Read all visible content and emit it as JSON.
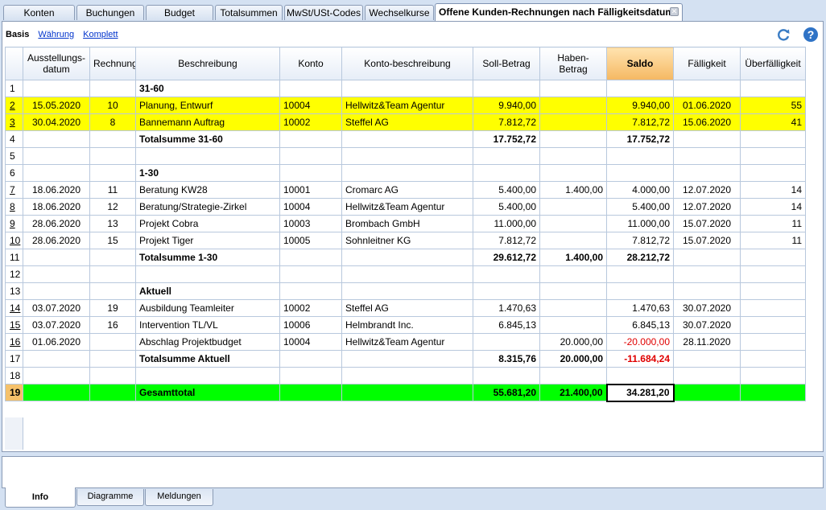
{
  "tabs": [
    {
      "label": "Konten"
    },
    {
      "label": "Buchungen"
    },
    {
      "label": "Budget"
    },
    {
      "label": "Totalsummen"
    },
    {
      "label": "MwSt/USt-Codes"
    },
    {
      "label": "Wechselkurse"
    },
    {
      "label": "Offene Kunden-Rechnungen nach Fälligkeitsdatum"
    }
  ],
  "views": {
    "basis": "Basis",
    "waehrung": "Währung",
    "komplett": "Komplett"
  },
  "icons": {
    "refresh": "refresh-icon",
    "help": "help-icon",
    "close": "close-icon"
  },
  "columns": {
    "date": "Ausstellungs-datum",
    "invoice": "Rechnung",
    "desc": "Beschreibung",
    "account": "Konto",
    "account_desc": "Konto-beschreibung",
    "debit": "Soll-Betrag",
    "credit": "Haben-Betrag",
    "balance": "Saldo",
    "due": "Fälligkeit",
    "overdue": "Überfälligkeit"
  },
  "rows": [
    {
      "n": "1",
      "date": "",
      "inv": "",
      "desc": "31-60",
      "acc": "",
      "accd": "",
      "debit": "",
      "credit": "",
      "bal": "",
      "due": "",
      "over": ""
    },
    {
      "n": "2",
      "date": "15.05.2020",
      "inv": "10",
      "desc": "Planung, Entwurf",
      "acc": "10004",
      "accd": "Hellwitz&Team Agentur",
      "debit": "9.940,00",
      "credit": "",
      "bal": "9.940,00",
      "due": "01.06.2020",
      "over": "55"
    },
    {
      "n": "3",
      "date": "30.04.2020",
      "inv": "8",
      "desc": "Bannemann Auftrag",
      "acc": "10002",
      "accd": "Steffel AG",
      "debit": "7.812,72",
      "credit": "",
      "bal": "7.812,72",
      "due": "15.06.2020",
      "over": "41"
    },
    {
      "n": "4",
      "date": "",
      "inv": "",
      "desc": "Totalsumme 31-60",
      "acc": "",
      "accd": "",
      "debit": "17.752,72",
      "credit": "",
      "bal": "17.752,72",
      "due": "",
      "over": ""
    },
    {
      "n": "5",
      "date": "",
      "inv": "",
      "desc": "",
      "acc": "",
      "accd": "",
      "debit": "",
      "credit": "",
      "bal": "",
      "due": "",
      "over": ""
    },
    {
      "n": "6",
      "date": "",
      "inv": "",
      "desc": "1-30",
      "acc": "",
      "accd": "",
      "debit": "",
      "credit": "",
      "bal": "",
      "due": "",
      "over": ""
    },
    {
      "n": "7",
      "date": "18.06.2020",
      "inv": "11",
      "desc": "Beratung KW28",
      "acc": "10001",
      "accd": "Cromarc AG",
      "debit": "5.400,00",
      "credit": "1.400,00",
      "bal": "4.000,00",
      "due": "12.07.2020",
      "over": "14"
    },
    {
      "n": "8",
      "date": "18.06.2020",
      "inv": "12",
      "desc": "Beratung/Strategie-Zirkel",
      "acc": "10004",
      "accd": "Hellwitz&Team Agentur",
      "debit": "5.400,00",
      "credit": "",
      "bal": "5.400,00",
      "due": "12.07.2020",
      "over": "14"
    },
    {
      "n": "9",
      "date": "28.06.2020",
      "inv": "13",
      "desc": "Projekt Cobra",
      "acc": "10003",
      "accd": "Brombach GmbH",
      "debit": "11.000,00",
      "credit": "",
      "bal": "11.000,00",
      "due": "15.07.2020",
      "over": "11"
    },
    {
      "n": "10",
      "date": "28.06.2020",
      "inv": "15",
      "desc": "Projekt Tiger",
      "acc": "10005",
      "accd": "Sohnleitner KG",
      "debit": "7.812,72",
      "credit": "",
      "bal": "7.812,72",
      "due": "15.07.2020",
      "over": "11"
    },
    {
      "n": "11",
      "date": "",
      "inv": "",
      "desc": "Totalsumme 1-30",
      "acc": "",
      "accd": "",
      "debit": "29.612,72",
      "credit": "1.400,00",
      "bal": "28.212,72",
      "due": "",
      "over": ""
    },
    {
      "n": "12",
      "date": "",
      "inv": "",
      "desc": "",
      "acc": "",
      "accd": "",
      "debit": "",
      "credit": "",
      "bal": "",
      "due": "",
      "over": ""
    },
    {
      "n": "13",
      "date": "",
      "inv": "",
      "desc": "Aktuell",
      "acc": "",
      "accd": "",
      "debit": "",
      "credit": "",
      "bal": "",
      "due": "",
      "over": ""
    },
    {
      "n": "14",
      "date": "03.07.2020",
      "inv": "19",
      "desc": "Ausbildung Teamleiter",
      "acc": "10002",
      "accd": "Steffel AG",
      "debit": "1.470,63",
      "credit": "",
      "bal": "1.470,63",
      "due": "30.07.2020",
      "over": ""
    },
    {
      "n": "15",
      "date": "03.07.2020",
      "inv": "16",
      "desc": "Intervention TL/VL",
      "acc": "10006",
      "accd": "Helmbrandt Inc.",
      "debit": "6.845,13",
      "credit": "",
      "bal": "6.845,13",
      "due": "30.07.2020",
      "over": ""
    },
    {
      "n": "16",
      "date": "01.06.2020",
      "inv": "",
      "desc": "Abschlag Projektbudget",
      "acc": "10004",
      "accd": "Hellwitz&Team Agentur",
      "debit": "",
      "credit": "20.000,00",
      "bal": "-20.000,00",
      "due": "28.11.2020",
      "over": ""
    },
    {
      "n": "17",
      "date": "",
      "inv": "",
      "desc": "Totalsumme Aktuell",
      "acc": "",
      "accd": "",
      "debit": "8.315,76",
      "credit": "20.000,00",
      "bal": "-11.684,24",
      "due": "",
      "over": ""
    },
    {
      "n": "18",
      "date": "",
      "inv": "",
      "desc": "",
      "acc": "",
      "accd": "",
      "debit": "",
      "credit": "",
      "bal": "",
      "due": "",
      "over": ""
    },
    {
      "n": "19",
      "date": "",
      "inv": "",
      "desc": "Gesamttotal",
      "acc": "",
      "accd": "",
      "debit": "55.681,20",
      "credit": "21.400,00",
      "bal": "34.281,20",
      "due": "",
      "over": ""
    }
  ],
  "bottom_tabs": [
    {
      "label": "Info"
    },
    {
      "label": "Diagramme"
    },
    {
      "label": "Meldungen"
    }
  ],
  "colors": {
    "highlight": "#ffff00",
    "total_row": "#00ff00",
    "negative": "#e00000",
    "saldo_header": "#f5b862"
  }
}
